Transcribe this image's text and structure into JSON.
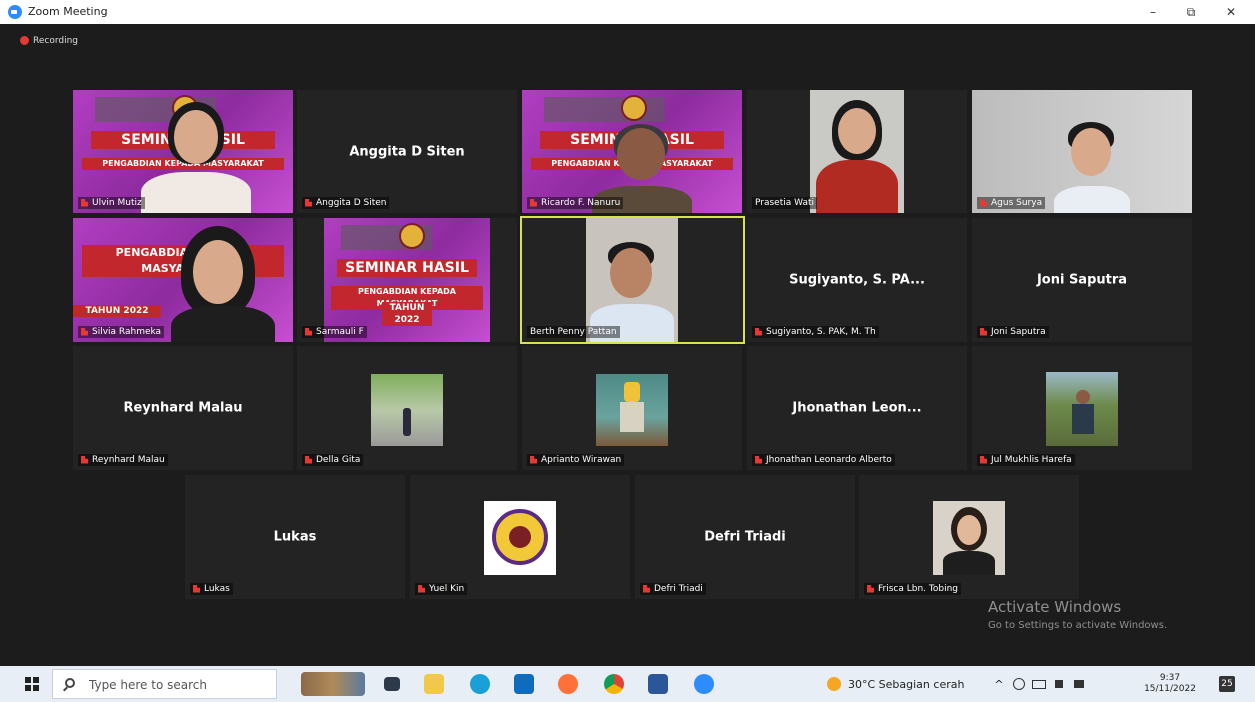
{
  "window": {
    "title": "Zoom Meeting",
    "minimize": "–",
    "maximize": "⧉",
    "close": "✕"
  },
  "recording": "Recording",
  "banner": {
    "title": "SEMINAR HASIL",
    "subtitle": "PENGABDIAN KEPADA MASYARAKAT",
    "year": "TAHUN 2022"
  },
  "participants": [
    {
      "label": "Ulvin Mutiz",
      "display": ""
    },
    {
      "label": "Anggita D Siten",
      "display": "Anggita D Siten"
    },
    {
      "label": "Ricardo F. Nanuru",
      "display": ""
    },
    {
      "label": "Prasetia Wati",
      "display": ""
    },
    {
      "label": "Agus Surya",
      "display": ""
    },
    {
      "label": "Silvia Rahmeka",
      "display": ""
    },
    {
      "label": "Sarmauli F",
      "display": ""
    },
    {
      "label": "Berth Penny Pattan",
      "display": ""
    },
    {
      "label": "Sugiyanto, S. PAK, M. Th",
      "display": "Sugiyanto, S. PA..."
    },
    {
      "label": "Joni Saputra",
      "display": "Joni Saputra"
    },
    {
      "label": "Reynhard Malau",
      "display": "Reynhard Malau"
    },
    {
      "label": "Della Gita",
      "display": ""
    },
    {
      "label": "Aprianto Wirawan",
      "display": ""
    },
    {
      "label": "Jhonathan Leonardo Alberto",
      "display": "Jhonathan  Leon..."
    },
    {
      "label": "Jul Mukhlis Harefa",
      "display": ""
    },
    {
      "label": "Lukas",
      "display": "Lukas"
    },
    {
      "label": "Yuel Kin",
      "display": ""
    },
    {
      "label": "Defri Triadi",
      "display": "Defri Triadi"
    },
    {
      "label": "Frisca Lbn. Tobing",
      "display": ""
    }
  ],
  "watermark": {
    "line1": "Activate Windows",
    "line2": "Go to Settings to activate Windows."
  },
  "taskbar": {
    "search_placeholder": "Type here to search",
    "weather": "30°C  Sebagian cerah",
    "time": "9:37",
    "date": "15/11/2022",
    "notifications": "25"
  },
  "colors": {
    "active_speaker": "#d7e34a",
    "tile_bg": "#232323",
    "muted_mic": "#e53935",
    "banner": "#b23ec2",
    "zoom_blue": "#2d8cff"
  }
}
